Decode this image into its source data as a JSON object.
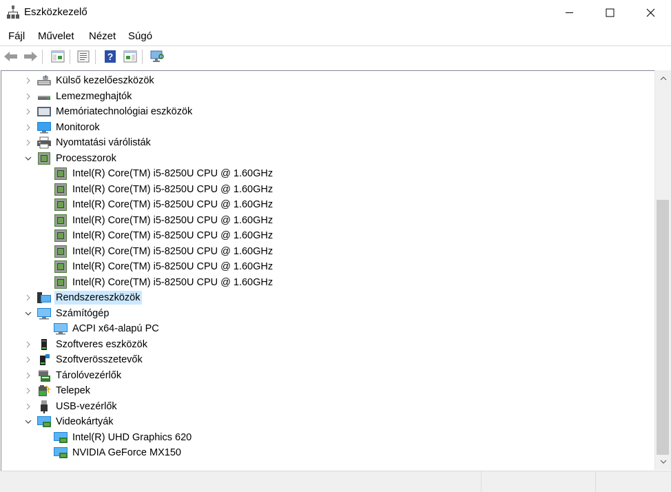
{
  "window": {
    "title": "Eszközkezelő"
  },
  "menu": [
    "Fájl",
    "Művelet",
    "Nézet",
    "Súgó"
  ],
  "toolbar": {
    "buttons": [
      "back-icon",
      "forward-icon",
      "show-hide-console-tree-icon",
      "properties-icon",
      "help-icon",
      "action-pane-icon",
      "monitor-icon"
    ]
  },
  "tree": {
    "items": [
      {
        "label": "Külső kezelőeszközök",
        "level": 0,
        "expanded": false,
        "icon": "keyboard-icon"
      },
      {
        "label": "Lemezmeghajtók",
        "level": 0,
        "expanded": false,
        "icon": "disk-drive-icon"
      },
      {
        "label": "Memóriatechnológiai eszközök",
        "level": 0,
        "expanded": false,
        "icon": "memory-device-icon"
      },
      {
        "label": "Monitorok",
        "level": 0,
        "expanded": false,
        "icon": "monitor-icon"
      },
      {
        "label": "Nyomtatási várólisták",
        "level": 0,
        "expanded": false,
        "icon": "printer-icon"
      },
      {
        "label": "Processzorok",
        "level": 0,
        "expanded": true,
        "icon": "processor-icon"
      },
      {
        "label": "Intel(R) Core(TM) i5-8250U CPU @ 1.60GHz",
        "level": 1,
        "icon": "processor-icon"
      },
      {
        "label": "Intel(R) Core(TM) i5-8250U CPU @ 1.60GHz",
        "level": 1,
        "icon": "processor-icon"
      },
      {
        "label": "Intel(R) Core(TM) i5-8250U CPU @ 1.60GHz",
        "level": 1,
        "icon": "processor-icon"
      },
      {
        "label": "Intel(R) Core(TM) i5-8250U CPU @ 1.60GHz",
        "level": 1,
        "icon": "processor-icon"
      },
      {
        "label": "Intel(R) Core(TM) i5-8250U CPU @ 1.60GHz",
        "level": 1,
        "icon": "processor-icon"
      },
      {
        "label": "Intel(R) Core(TM) i5-8250U CPU @ 1.60GHz",
        "level": 1,
        "icon": "processor-icon"
      },
      {
        "label": "Intel(R) Core(TM) i5-8250U CPU @ 1.60GHz",
        "level": 1,
        "icon": "processor-icon"
      },
      {
        "label": "Intel(R) Core(TM) i5-8250U CPU @ 1.60GHz",
        "level": 1,
        "icon": "processor-icon"
      },
      {
        "label": "Rendszereszközök",
        "level": 0,
        "expanded": false,
        "selected": true,
        "icon": "system-devices-icon"
      },
      {
        "label": "Számítógép",
        "level": 0,
        "expanded": true,
        "icon": "computer-icon"
      },
      {
        "label": "ACPI x64-alapú PC",
        "level": 1,
        "icon": "computer-icon"
      },
      {
        "label": "Szoftveres eszközök",
        "level": 0,
        "expanded": false,
        "icon": "software-device-icon"
      },
      {
        "label": "Szoftverösszetevők",
        "level": 0,
        "expanded": false,
        "icon": "software-component-icon"
      },
      {
        "label": "Tárolóvezérlők",
        "level": 0,
        "expanded": false,
        "icon": "storage-controller-icon"
      },
      {
        "label": "Telepek",
        "level": 0,
        "expanded": false,
        "icon": "battery-icon"
      },
      {
        "label": "USB-vezérlők",
        "level": 0,
        "expanded": false,
        "icon": "usb-icon"
      },
      {
        "label": "Videokártyák",
        "level": 0,
        "expanded": true,
        "icon": "display-adapter-icon"
      },
      {
        "label": "Intel(R) UHD Graphics 620",
        "level": 1,
        "icon": "display-adapter-icon"
      },
      {
        "label": "NVIDIA GeForce MX150",
        "level": 1,
        "icon": "display-adapter-icon"
      }
    ]
  },
  "colors": {
    "selection": "#cce8ff",
    "accent": "#0078d7"
  }
}
